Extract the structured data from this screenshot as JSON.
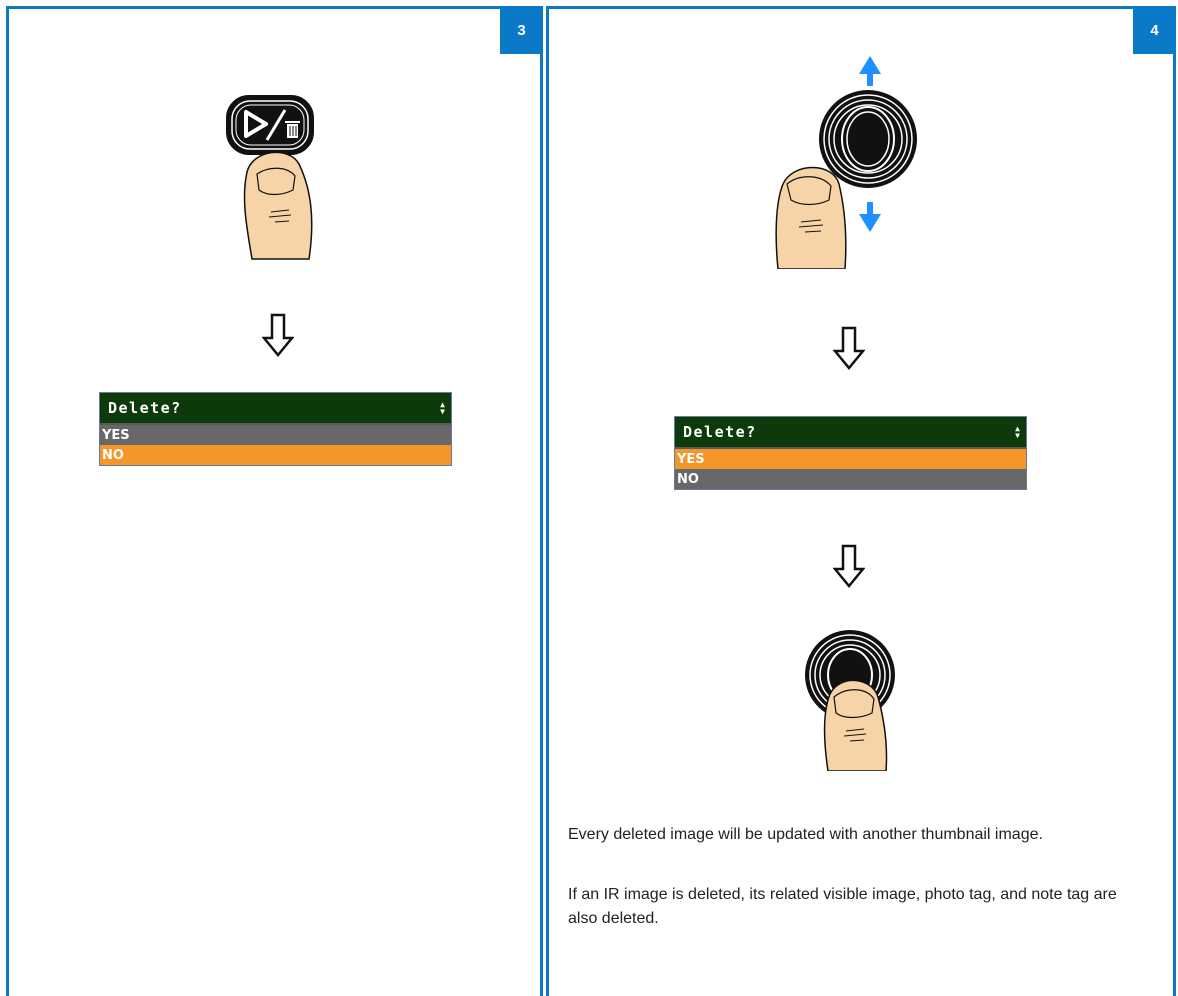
{
  "steps": [
    {
      "number": "3",
      "menu": {
        "title": "Delete?",
        "options": [
          "YES",
          "NO"
        ],
        "selected": "NO"
      }
    },
    {
      "number": "4",
      "menu": {
        "title": "Delete?",
        "options": [
          "YES",
          "NO"
        ],
        "selected": "YES"
      },
      "paragraphs": [
        "Every deleted image will be updated with another thumbnail image.",
        "If an IR image is deleted, its related visible image, photo tag, and note tag are also deleted."
      ]
    }
  ],
  "colors": {
    "accent_blue": "#0a7ac8",
    "menu_header": "#0d3a0b",
    "menu_row": "#686868",
    "menu_selected": "#f4962a",
    "skin": "#f7d3a8",
    "nav_arrow": "#1e90ff"
  },
  "icons": [
    "play-delete-button-icon",
    "joystick-icon",
    "down-arrow-icon",
    "finger-icon",
    "up-down-arrows-icon"
  ]
}
